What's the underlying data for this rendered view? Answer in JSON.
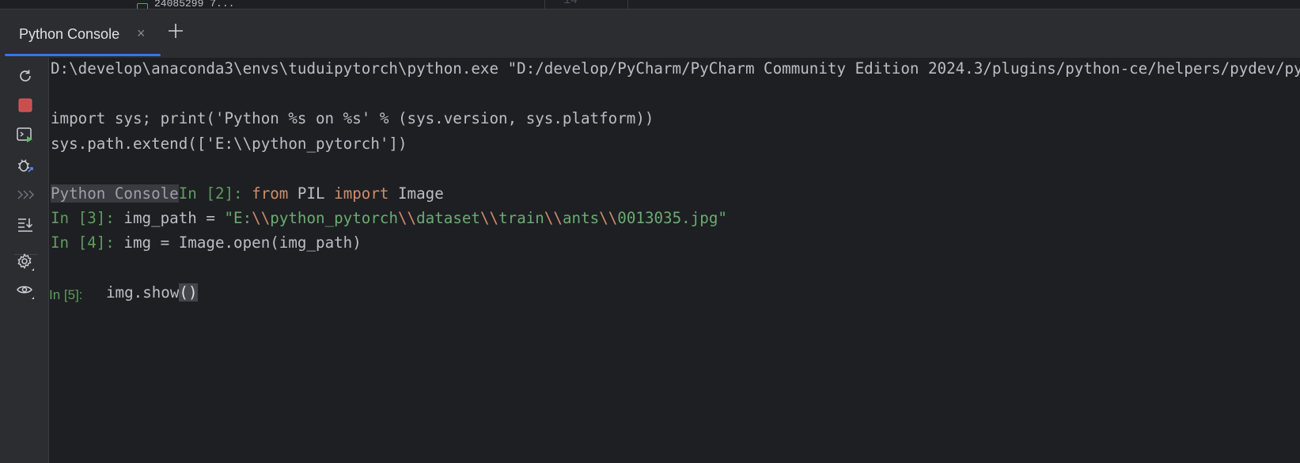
{
  "top_strip": {
    "file_text": "24085299 7...",
    "line_number": "14"
  },
  "tabs": [
    {
      "label": "Python Console",
      "close": "×"
    }
  ],
  "add_tab_label": "+",
  "toolbar": {
    "items": [
      {
        "name": "rerun-icon"
      },
      {
        "name": "stop-icon"
      },
      {
        "name": "new-console-icon"
      },
      {
        "name": "attach-debugger-icon"
      },
      {
        "name": "execute-history-icon"
      },
      {
        "name": "scroll-to-end-icon"
      },
      {
        "name": "settings-icon"
      },
      {
        "name": "variables-view-icon"
      }
    ]
  },
  "console": {
    "line1": "D:\\develop\\anaconda3\\envs\\tuduipytorch\\python.exe \"D:/develop/PyCharm/PyCharm Community Edition 2024.3/plugins/python-ce/helpers/pydev/pydevconsole.py\"",
    "line2": "import sys; print('Python %s on %s' % (sys.version, sys.platform))",
    "line3": "sys.path.extend(['E:\\\\python_pytorch'])",
    "line4": {
      "label": "Python Console",
      "prompt": "In [2]: ",
      "kw_from": "from",
      "module": " PIL ",
      "kw_import": "import",
      "name": " Image"
    },
    "line5": {
      "prompt": "In [3]: ",
      "code": "img_path = ",
      "s1": "\"E:",
      "e1": "\\\\",
      "s2": "python_pytorch",
      "e2": "\\\\",
      "s3": "dataset",
      "e3": "\\\\",
      "s4": "train",
      "e4": "\\\\",
      "s5": "ants",
      "e5": "\\\\",
      "s6": "0013035.jpg\""
    },
    "line6": {
      "prompt": "In [4]: ",
      "code": "img = Image.open(img_path)"
    },
    "input": {
      "prompt": "In [5]:",
      "code": "img.show",
      "paren": "()"
    }
  }
}
